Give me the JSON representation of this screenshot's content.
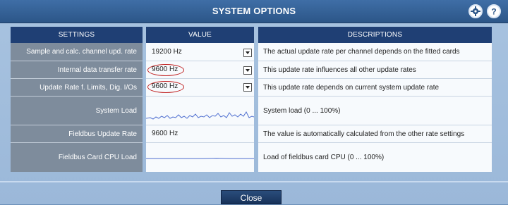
{
  "window": {
    "title": "SYSTEM OPTIONS"
  },
  "columns": {
    "settings": "SETTINGS",
    "value": "VALUE",
    "descriptions": "DESCRIPTIONS"
  },
  "rows": [
    {
      "setting": "Sample and calc. channel upd. rate",
      "value": "19200 Hz",
      "description": "The actual update rate per channel depends on the fitted cards"
    },
    {
      "setting": "Internal data transfer rate",
      "value": "9600 Hz",
      "description": "This update rate influences all other update rates"
    },
    {
      "setting": "Update Rate f. Limits, Dig. I/Os",
      "value": "9600 Hz",
      "description": "This update rate depends on current system update rate"
    },
    {
      "setting": "System Load",
      "value": "",
      "description": "System load (0 ... 100%)"
    },
    {
      "setting": "Fieldbus Update Rate",
      "value": "9600 Hz",
      "description": "The value is automatically calculated from the other rate settings"
    },
    {
      "setting": "Fieldbus Card CPU Load",
      "value": "",
      "description": "Load of fieldbus card CPU (0 ... 100%)"
    }
  ],
  "footer": {
    "close_label": "Close"
  },
  "colors": {
    "header": "#1f3f74",
    "titlebar": "#2c5688",
    "highlight": "#c02020",
    "graph": "#4f6fd0"
  },
  "icons": [
    "settings-gear-icon",
    "help-icon",
    "dropdown-arrow-icon"
  ]
}
